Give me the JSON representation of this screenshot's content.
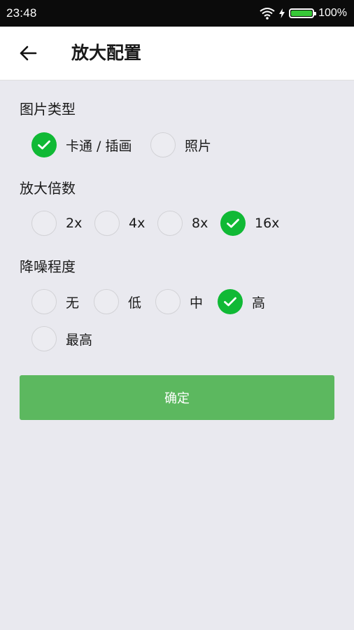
{
  "status_bar": {
    "time": "23:48",
    "battery_text": "100%",
    "battery_level": 1.0
  },
  "header": {
    "title": "放大配置",
    "back_icon": "arrow-left-icon"
  },
  "sections": [
    {
      "label": "图片类型",
      "options": [
        {
          "label": "卡通 / 插画",
          "checked": true
        },
        {
          "label": "照片",
          "checked": false
        }
      ]
    },
    {
      "label": "放大倍数",
      "options": [
        {
          "label": "2x",
          "checked": false
        },
        {
          "label": "4x",
          "checked": false
        },
        {
          "label": "8x",
          "checked": false
        },
        {
          "label": "16x",
          "checked": true
        }
      ]
    },
    {
      "label": "降噪程度",
      "options": [
        {
          "label": "无",
          "checked": false
        },
        {
          "label": "低",
          "checked": false
        },
        {
          "label": "中",
          "checked": false
        },
        {
          "label": "高",
          "checked": true
        },
        {
          "label": "最高",
          "checked": false
        }
      ]
    }
  ],
  "confirm_label": "确定",
  "colors": {
    "accent": "#10b935",
    "button": "#5cb85f",
    "background": "#e9e9ef"
  }
}
